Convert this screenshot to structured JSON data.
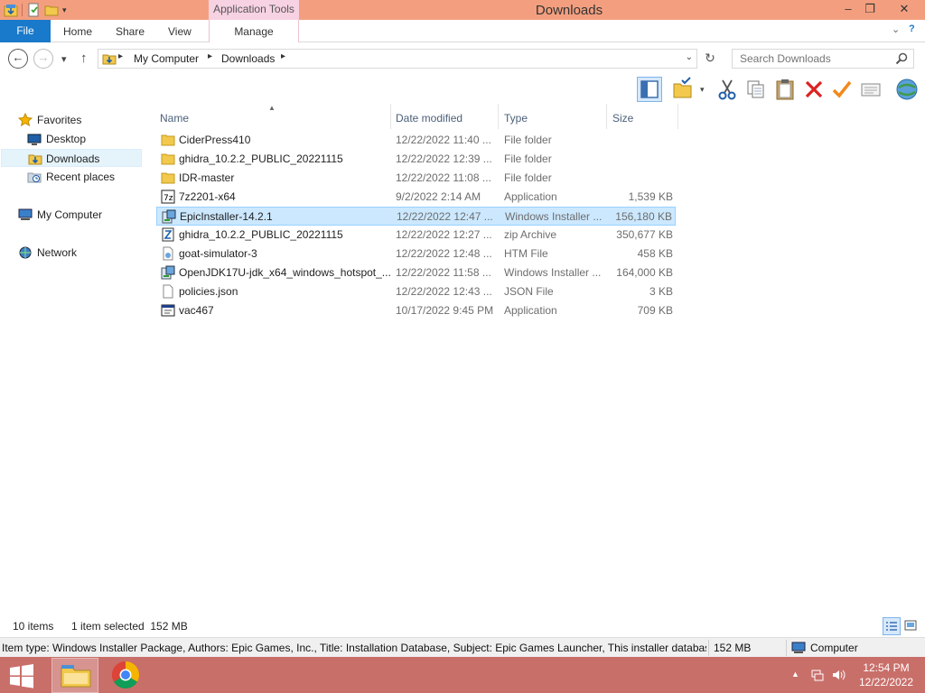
{
  "window": {
    "title": "Downloads",
    "contextual_tab_group": "Application Tools",
    "controls": {
      "minimize": "–",
      "restore": "❐",
      "close": "✕"
    }
  },
  "ribbon": {
    "file_tab": "File",
    "tabs": [
      "Home",
      "Share",
      "View"
    ],
    "contextual_tab": "Manage",
    "collapse_glyph": "⌄",
    "help_glyph": "?"
  },
  "address_bar": {
    "breadcrumbs": [
      "My Computer",
      "Downloads"
    ],
    "back_glyph": "←",
    "forward_glyph": "→",
    "recent_glyph": "▾",
    "up_glyph": "↑",
    "refresh_glyph": "↻"
  },
  "search": {
    "placeholder": "Search Downloads"
  },
  "navigation": {
    "favorites_label": "Favorites",
    "favorites": [
      {
        "label": "Desktop",
        "icon": "desktop-icon",
        "selected": false
      },
      {
        "label": "Downloads",
        "icon": "downloads-folder-icon",
        "selected": true
      },
      {
        "label": "Recent places",
        "icon": "recent-places-icon",
        "selected": false
      }
    ],
    "computer_label": "My Computer",
    "network_label": "Network"
  },
  "file_list": {
    "columns": {
      "name": "Name",
      "date": "Date modified",
      "type": "Type",
      "size": "Size"
    },
    "rows": [
      {
        "name": "CiderPress410",
        "date": "12/22/2022 11:40 ...",
        "type": "File folder",
        "size": "",
        "icon": "folder-icon",
        "selected": false
      },
      {
        "name": "ghidra_10.2.2_PUBLIC_20221115",
        "date": "12/22/2022 12:39 ...",
        "type": "File folder",
        "size": "",
        "icon": "folder-icon",
        "selected": false
      },
      {
        "name": "IDR-master",
        "date": "12/22/2022 11:08 ...",
        "type": "File folder",
        "size": "",
        "icon": "folder-icon",
        "selected": false
      },
      {
        "name": "7z2201-x64",
        "date": "9/2/2022 2:14 AM",
        "type": "Application",
        "size": "1,539 KB",
        "icon": "7zip-app-icon",
        "selected": false
      },
      {
        "name": "EpicInstaller-14.2.1",
        "date": "12/22/2022 12:47 ...",
        "type": "Windows Installer ...",
        "size": "156,180 KB",
        "icon": "installer-icon",
        "selected": true
      },
      {
        "name": "ghidra_10.2.2_PUBLIC_20221115",
        "date": "12/22/2022 12:27 ...",
        "type": "zip Archive",
        "size": "350,677 KB",
        "icon": "zip-archive-icon",
        "selected": false
      },
      {
        "name": "goat-simulator-3",
        "date": "12/22/2022 12:48 ...",
        "type": "HTM File",
        "size": "458 KB",
        "icon": "htm-file-icon",
        "selected": false
      },
      {
        "name": "OpenJDK17U-jdk_x64_windows_hotspot_...",
        "date": "12/22/2022 11:58 ...",
        "type": "Windows Installer ...",
        "size": "164,000 KB",
        "icon": "installer-icon",
        "selected": false
      },
      {
        "name": "policies.json",
        "date": "12/22/2022 12:43 ...",
        "type": "JSON File",
        "size": "3 KB",
        "icon": "json-file-icon",
        "selected": false
      },
      {
        "name": "vac467",
        "date": "10/17/2022 9:45 PM",
        "type": "Application",
        "size": "709 KB",
        "icon": "application-icon",
        "selected": false
      }
    ]
  },
  "status": {
    "item_count": "10 items",
    "selection": "1 item selected  152 MB"
  },
  "details": {
    "text": "Item type: Windows Installer Package, Authors: Epic Games, Inc., Title: Installation Database, Subject: Epic Games Launcher, This installer database co",
    "size": "152 MB",
    "location": "Computer"
  },
  "taskbar": {
    "time": "12:54 PM",
    "date": "12/22/2022",
    "apps": [
      "file-explorer-icon",
      "chrome-icon"
    ]
  },
  "colors": {
    "title_bar": "#f39f7f",
    "file_tab": "#1979ca",
    "taskbar": "#c96f6a",
    "selection": "#cce8ff"
  }
}
